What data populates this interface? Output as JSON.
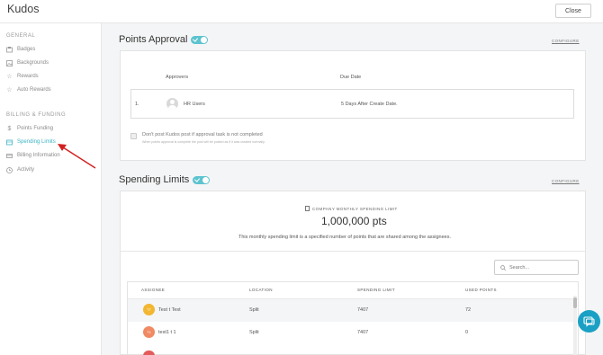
{
  "app": {
    "title": "Kudos",
    "close_label": "Close"
  },
  "sidebar": {
    "sections": [
      {
        "label": "GENERAL"
      },
      {
        "label": "BILLING & FUNDING"
      }
    ],
    "items": [
      {
        "label": "Badges",
        "icon": "badge-icon"
      },
      {
        "label": "Backgrounds",
        "icon": "image-icon"
      },
      {
        "label": "Rewards",
        "icon": "star-icon"
      },
      {
        "label": "Auto Rewards",
        "icon": "star-outline-icon"
      },
      {
        "label": "Points Funding",
        "icon": "dollar-icon"
      },
      {
        "label": "Spending Limits",
        "icon": "wallet-icon",
        "active": true
      },
      {
        "label": "Billing Information",
        "icon": "card-icon"
      },
      {
        "label": "Activity",
        "icon": "clock-icon"
      }
    ]
  },
  "points_approval": {
    "title": "Points Approval",
    "configure": "CONFIGURE",
    "columns": {
      "approvers": "Approvers",
      "due_date": "Due Date"
    },
    "row": {
      "index": "1.",
      "approver": "HR Users",
      "due_date": "5 Days After Create Date."
    },
    "checkbox_label": "Don't post Kudos post if approval task is not completed",
    "checkbox_help": "When points approval is complete the post will be posted as if it was created normally."
  },
  "spending_limits": {
    "title": "Spending Limits",
    "configure": "CONFIGURE",
    "limit_label": "COMPANY MONTHLY SPENDING LIMIT",
    "limit_value": "1,000,000 pts",
    "description": "This monthly spending limit is a specified number of points that are shared among the assignees.",
    "search_placeholder": "Search...",
    "columns": {
      "assignee": "ASSIGNEE",
      "location": "LOCATION",
      "limit": "SPENDING LIMIT",
      "used": "USED POINTS"
    },
    "rows": [
      {
        "initials": "TT",
        "assignee": "Test t Test",
        "location": "Split",
        "limit": "7407",
        "used": "72",
        "color": "#f2b630"
      },
      {
        "initials": "T1",
        "assignee": "test1 t 1",
        "location": "Split",
        "limit": "7407",
        "used": "0",
        "color": "#ef8a63"
      }
    ]
  },
  "colors": {
    "accent": "#5cc3cf",
    "active_link": "#3db3c4",
    "chat": "#1aa0c4",
    "arrow": "#d22020"
  }
}
